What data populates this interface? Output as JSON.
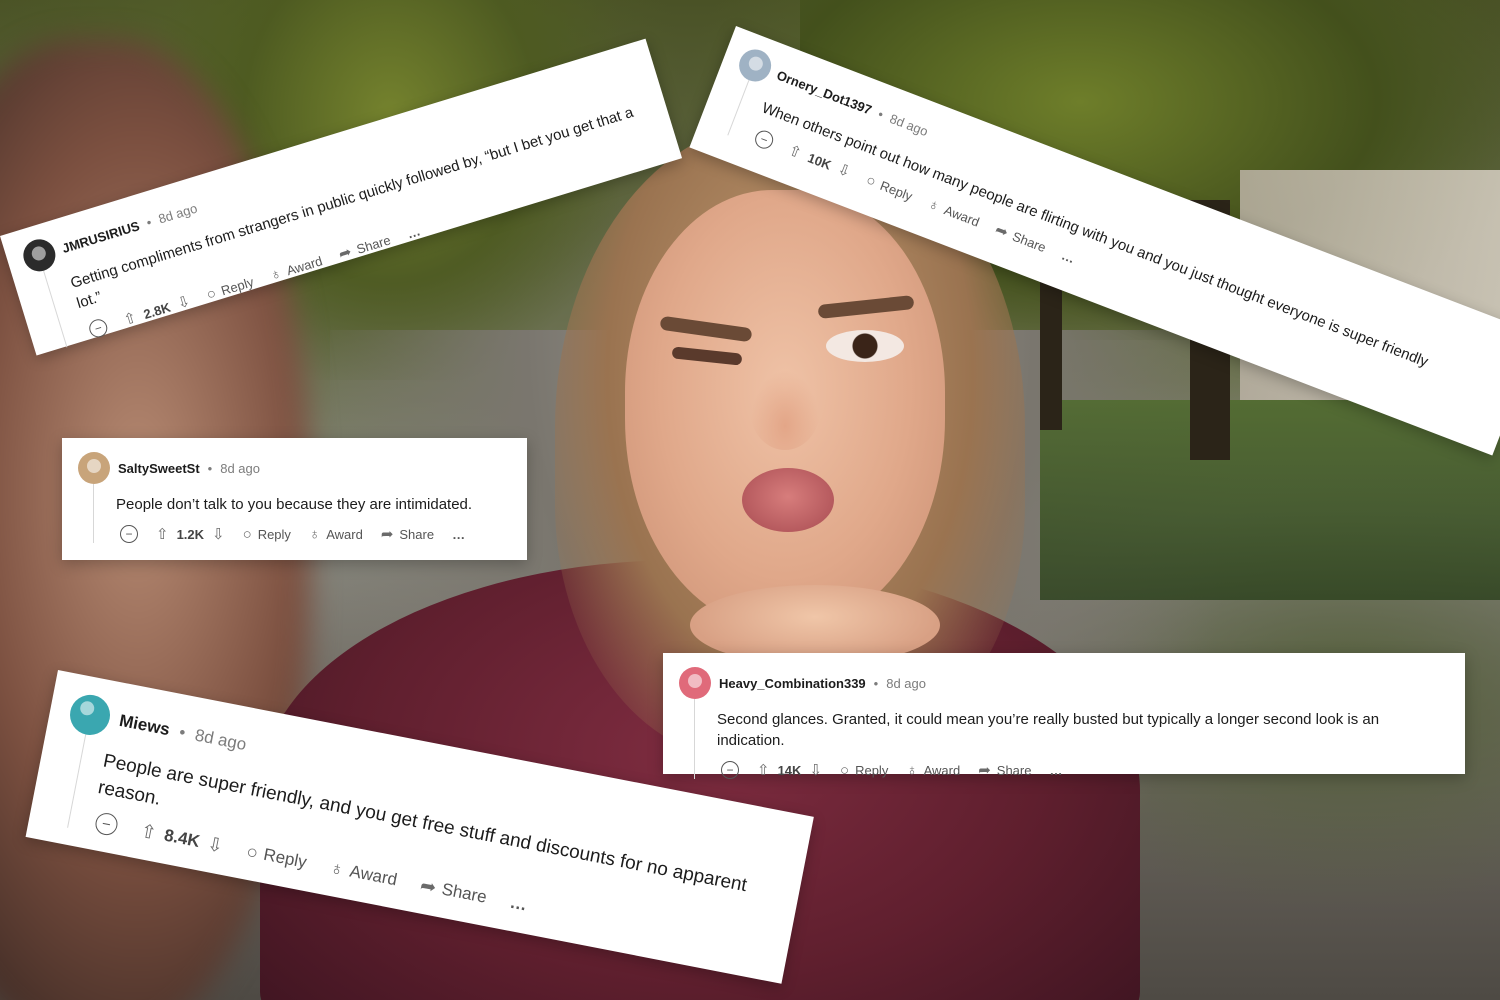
{
  "comments": [
    {
      "username": "JMRUSIRIUS",
      "age": "8d ago",
      "text": "Getting compliments from strangers in public quickly followed by, “but I bet you get that a lot.”",
      "score": "2.8K",
      "avatar_color": "#2b2b2b"
    },
    {
      "username": "Ornery_Dot1397",
      "age": "8d ago",
      "text": "When others point out how many people are flirting with you and you just thought everyone is super friendly",
      "score": "10K",
      "avatar_color": "#9fb2c4"
    },
    {
      "username": "SaltySweetSt",
      "age": "8d ago",
      "text": "People don’t talk to you because they are intimidated.",
      "score": "1.2K",
      "avatar_color": "#c8a47a"
    },
    {
      "username": "Heavy_Combination339",
      "age": "8d ago",
      "text": "Second glances. Granted, it could mean you’re really busted but typically a longer second look is an indication.",
      "score": "14K",
      "avatar_color": "#e06a7a"
    },
    {
      "username": "Miews",
      "age": "8d ago",
      "text": "People are super friendly, and you get free stuff and discounts for no apparent reason.",
      "score": "8.4K",
      "avatar_color": "#3aa7b0"
    }
  ],
  "actions": {
    "reply": "Reply",
    "award": "Award",
    "share": "Share",
    "more": "…"
  },
  "icons": {
    "collapse": "collapse-icon",
    "upvote": "upvote-icon",
    "downvote": "downvote-icon",
    "reply": "speech-bubble-icon",
    "award": "award-ribbon-icon",
    "share": "share-arrow-icon"
  },
  "separator": "•"
}
